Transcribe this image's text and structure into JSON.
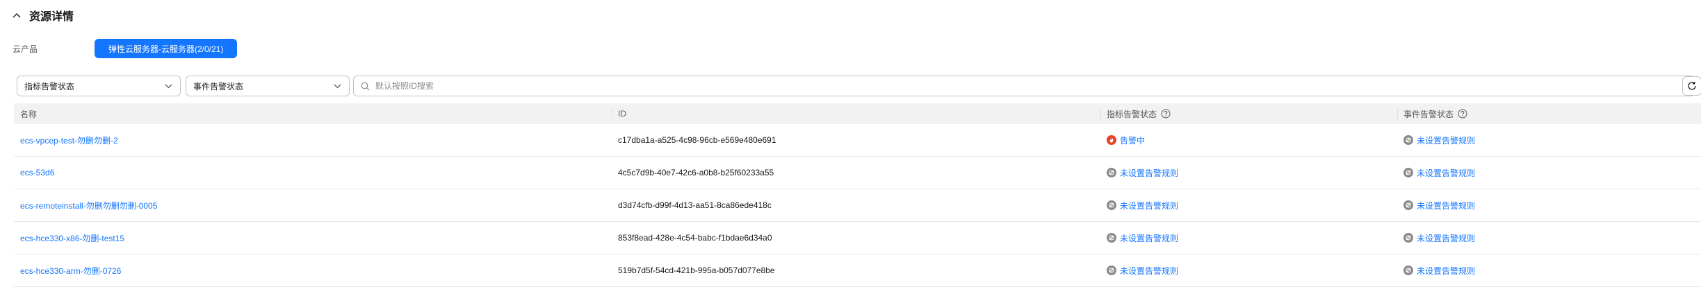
{
  "section": {
    "title": "资源详情",
    "icon": "chevron-up-icon"
  },
  "product": {
    "label": "云产品",
    "button_label": "弹性云服务器-云服务器(2/0/21)"
  },
  "filters": {
    "metric_select": "指标告警状态",
    "event_select": "事件告警状态",
    "search_placeholder": "默认按照ID搜索"
  },
  "table": {
    "columns": [
      "名称",
      "ID",
      "指标告警状态",
      "事件告警状态"
    ],
    "rows": [
      {
        "name": "ecs-vpcep-test-勿删勿删-2",
        "id": "c17dba1a-a525-4c98-96cb-e569e480e691",
        "metric": {
          "text": "告警中",
          "icon": "fire-icon"
        },
        "event": {
          "text": "未设置告警规则",
          "icon": "unset-icon"
        }
      },
      {
        "name": "ecs-53d6",
        "id": "4c5c7d9b-40e7-42c6-a0b8-b25f60233a55",
        "metric": {
          "text": "未设置告警规则",
          "icon": "unset-icon"
        },
        "event": {
          "text": "未设置告警规则",
          "icon": "unset-icon"
        }
      },
      {
        "name": "ecs-remoteinstall-勿删勿删勿删-0005",
        "id": "d3d74cfb-d99f-4d13-aa51-8ca86ede418c",
        "metric": {
          "text": "未设置告警规则",
          "icon": "unset-icon"
        },
        "event": {
          "text": "未设置告警规则",
          "icon": "unset-icon"
        }
      },
      {
        "name": "ecs-hce330-x86-勿删-test15",
        "id": "853f8ead-428e-4c54-babc-f1bdae6d34a0",
        "metric": {
          "text": "未设置告警规则",
          "icon": "unset-icon"
        },
        "event": {
          "text": "未设置告警规则",
          "icon": "unset-icon"
        }
      },
      {
        "name": "ecs-hce330-arm-勿删-0726",
        "id": "519b7d5f-54cd-421b-995a-b057d077e8be",
        "metric": {
          "text": "未设置告警规则",
          "icon": "unset-icon"
        },
        "event": {
          "text": "未设置告警规则",
          "icon": "unset-icon"
        }
      }
    ]
  },
  "colors": {
    "accent": "#1476ff",
    "alarm": "#e84026",
    "unset": "#8a8a8a"
  }
}
